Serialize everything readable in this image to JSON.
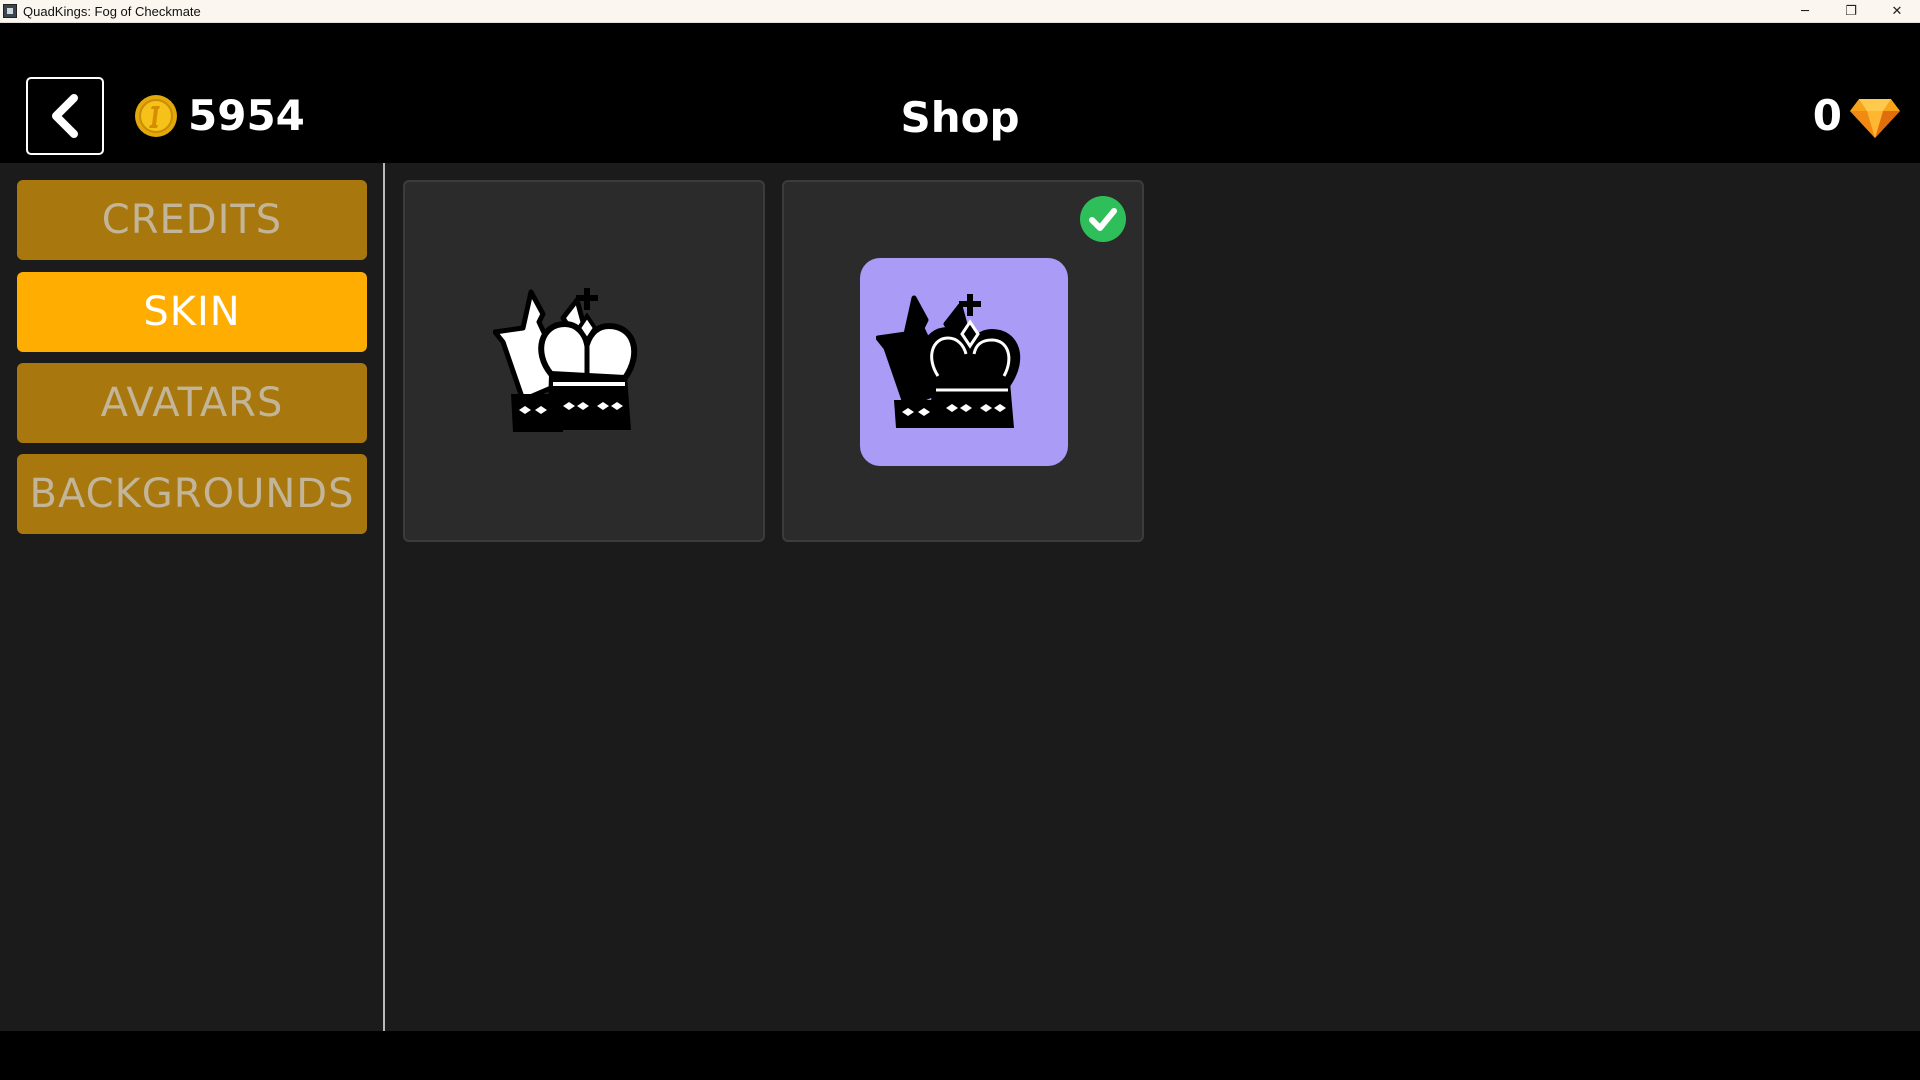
{
  "window": {
    "title": "QuadKings: Fog of Checkmate",
    "minimize_glyph": "─",
    "restore_glyph": "❐",
    "close_glyph": "✕"
  },
  "header": {
    "back_icon": "chevron-left-icon",
    "coin_icon": "coin-icon",
    "coins": "5954",
    "title": "Shop",
    "gems": "0",
    "gem_icon": "diamond-icon"
  },
  "sidebar": {
    "tabs": [
      {
        "label": "CREDITS",
        "active": false
      },
      {
        "label": "SKIN",
        "active": true
      },
      {
        "label": "AVATARS",
        "active": false
      },
      {
        "label": "BACKGROUNDS",
        "active": false
      }
    ]
  },
  "skins": [
    {
      "icon": "white-king-icon",
      "selected": false
    },
    {
      "icon": "black-king-icon",
      "selected": true
    }
  ],
  "colors": {
    "accent": "#ffad00",
    "tab_inactive": "#a8780e",
    "selected_tile": "#a99bf6",
    "check": "#2fbf5a",
    "panel": "#1b1b1b",
    "card": "#2b2b2b"
  }
}
